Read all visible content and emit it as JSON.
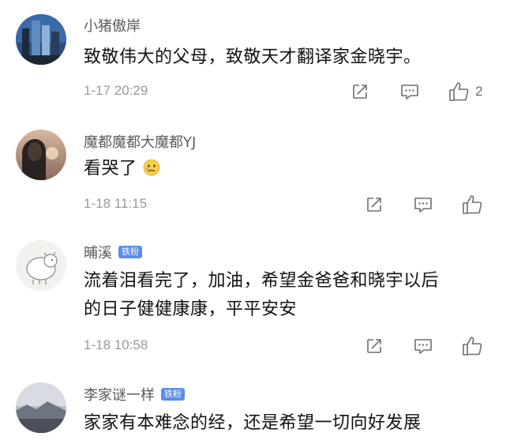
{
  "comments": [
    {
      "username": "小猪傲岸",
      "badge": "",
      "text": "致敬伟大的父母，致敬天才翻译家金晓宇。",
      "timestamp": "1-17 20:29",
      "like_count": "2",
      "avatar_icon": "city-skyline-avatar"
    },
    {
      "username": "魔都魔都大魔都YJ",
      "badge": "",
      "text": "看哭了",
      "emoji": "crying-face-emoji",
      "timestamp": "1-18 11:15",
      "like_count": "",
      "avatar_icon": "portrait-avatar"
    },
    {
      "username": "晡溪",
      "badge": "铁粉",
      "text_line1": "流着泪看完了，加油，希望金爸爸和晓宇以后",
      "text_line2": "的日子健健康康，平平安安",
      "timestamp": "1-18 10:58",
      "like_count": "",
      "avatar_icon": "cartoon-sheep-avatar"
    },
    {
      "username": "李家谜一样",
      "badge": "铁粉",
      "text": "家家有本难念的经，还是希望一切向好发展",
      "avatar_icon": "landscape-avatar"
    }
  ],
  "icons": {
    "share": "share-icon",
    "reply": "reply-icon",
    "like": "thumbs-up-icon"
  },
  "colors": {
    "badge": "#5b8def",
    "username": "#5b5b5b",
    "timestamp": "#9a9a9a",
    "text": "#111111"
  }
}
